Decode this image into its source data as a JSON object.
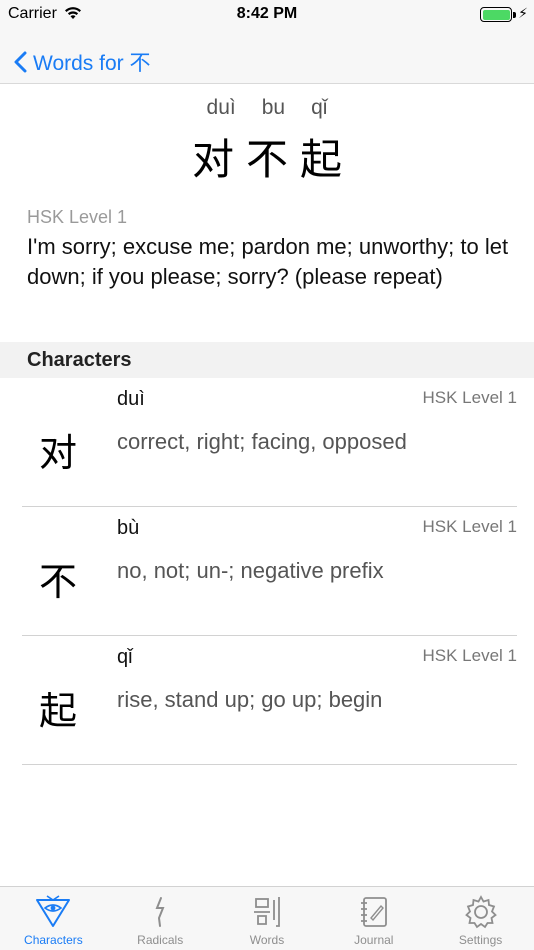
{
  "status_bar": {
    "carrier": "Carrier",
    "time": "8:42 PM",
    "battery_percent": 100
  },
  "nav": {
    "back_label": "Words for 不",
    "accent_color": "#1a7cf5"
  },
  "word": {
    "pinyin": [
      "duì",
      "bu",
      "qǐ"
    ],
    "hanzi": [
      "对",
      "不",
      "起"
    ],
    "hsk": "HSK Level 1",
    "definition": "I'm sorry; excuse me; pardon me; unworthy; to let down; if you please; sorry? (please repeat)"
  },
  "characters_section": {
    "title": "Characters",
    "items": [
      {
        "char": "对",
        "pinyin": "duì",
        "hsk": "HSK Level 1",
        "definition": "correct, right; facing, opposed"
      },
      {
        "char": "不",
        "pinyin": "bù",
        "hsk": "HSK Level 1",
        "definition": "no, not; un-; negative prefix"
      },
      {
        "char": "起",
        "pinyin": "qǐ",
        "hsk": "HSK Level 1",
        "definition": "rise, stand up; go up; begin"
      }
    ]
  },
  "tab_bar": {
    "tabs": [
      {
        "label": "Characters",
        "icon": "characters-icon",
        "active": true
      },
      {
        "label": "Radicals",
        "icon": "radicals-icon",
        "active": false
      },
      {
        "label": "Words",
        "icon": "words-icon",
        "active": false
      },
      {
        "label": "Journal",
        "icon": "journal-icon",
        "active": false
      },
      {
        "label": "Settings",
        "icon": "gear-icon",
        "active": false
      }
    ]
  }
}
